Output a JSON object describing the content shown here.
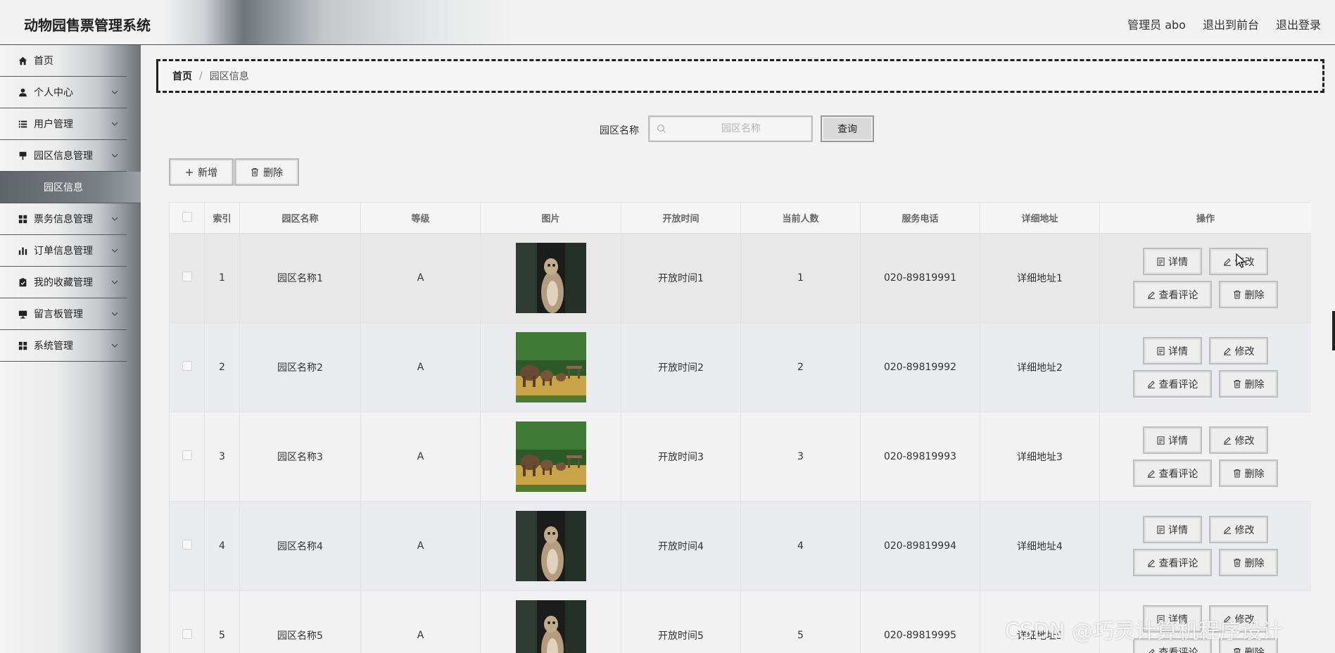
{
  "header": {
    "app_title": "动物园售票管理系统",
    "admin_label": "管理员 abo",
    "front_label": "退出到前台",
    "logout_label": "退出登录"
  },
  "sidebar": {
    "items": [
      {
        "label": "首页",
        "icon": "home-icon"
      },
      {
        "label": "个人中心",
        "icon": "user-icon"
      },
      {
        "label": "用户管理",
        "icon": "list-icon"
      },
      {
        "label": "园区信息管理",
        "icon": "sign-icon"
      },
      {
        "label": "票务信息管理",
        "icon": "grid-icon"
      },
      {
        "label": "订单信息管理",
        "icon": "bar-chart-icon"
      },
      {
        "label": "我的收藏管理",
        "icon": "clipboard-check-icon"
      },
      {
        "label": "留言板管理",
        "icon": "monitor-icon"
      },
      {
        "label": "系统管理",
        "icon": "grid-icon"
      }
    ],
    "submenu_active": "园区信息"
  },
  "breadcrumb": {
    "home": "首页",
    "separator": "/",
    "current": "园区信息"
  },
  "search": {
    "label": "园区名称",
    "placeholder": "园区名称",
    "value": "",
    "query_label": "查询"
  },
  "toolbar": {
    "add_label": "新增",
    "delete_label": "删除"
  },
  "table": {
    "columns": [
      "索引",
      "园区名称",
      "等级",
      "图片",
      "开放时间",
      "当前人数",
      "服务电话",
      "详细地址",
      "操作"
    ],
    "rows": [
      {
        "index": "1",
        "name": "园区名称1",
        "level": "A",
        "image": "meerkat",
        "open_time": "开放时间1",
        "count": "1",
        "phone": "020-89819991",
        "address": "详细地址1"
      },
      {
        "index": "2",
        "name": "园区名称2",
        "level": "A",
        "image": "elephants",
        "open_time": "开放时间2",
        "count": "2",
        "phone": "020-89819992",
        "address": "详细地址2"
      },
      {
        "index": "3",
        "name": "园区名称3",
        "level": "A",
        "image": "elephants",
        "open_time": "开放时间3",
        "count": "3",
        "phone": "020-89819993",
        "address": "详细地址3"
      },
      {
        "index": "4",
        "name": "园区名称4",
        "level": "A",
        "image": "meerkat",
        "open_time": "开放时间4",
        "count": "4",
        "phone": "020-89819994",
        "address": "详细地址4"
      },
      {
        "index": "5",
        "name": "园区名称5",
        "level": "A",
        "image": "meerkat",
        "open_time": "开放时间5",
        "count": "5",
        "phone": "020-89819995",
        "address": "详细地址5"
      }
    ],
    "ops": {
      "detail": "详情",
      "edit": "修改",
      "review": "查看评论",
      "delete": "删除"
    }
  },
  "watermark": "CSDN @巧灵计算机程序设计"
}
